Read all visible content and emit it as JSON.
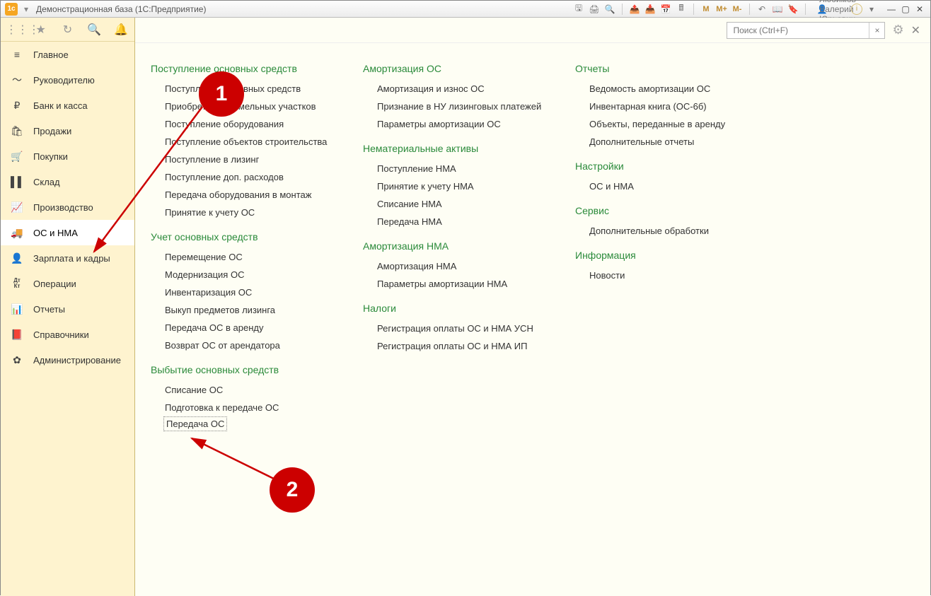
{
  "title": "Демонстрационная база  (1С:Предприятие)",
  "user": "Любимов Валерий Юрьевич",
  "toolbarLetters": {
    "m1": "M",
    "m2": "M+",
    "m3": "M-"
  },
  "search": {
    "placeholder": "Поиск (Ctrl+F)"
  },
  "nav": [
    {
      "icon": "≡",
      "label": "Главное"
    },
    {
      "icon": "〜",
      "label": "Руководителю"
    },
    {
      "icon": "₽",
      "label": "Банк и касса"
    },
    {
      "icon": "🛍",
      "label": "Продажи"
    },
    {
      "icon": "🛒",
      "label": "Покупки"
    },
    {
      "icon": "▌▌",
      "label": "Склад"
    },
    {
      "icon": "📈",
      "label": "Производство"
    },
    {
      "icon": "🚚",
      "label": "ОС и НМА",
      "active": true
    },
    {
      "icon": "👤",
      "label": "Зарплата и кадры"
    },
    {
      "icon": "Дт\nКт",
      "label": "Операции"
    },
    {
      "icon": "📊",
      "label": "Отчеты"
    },
    {
      "icon": "📕",
      "label": "Справочники"
    },
    {
      "icon": "✿",
      "label": "Администрирование"
    }
  ],
  "col1": [
    {
      "title": "Поступление основных средств",
      "items": [
        "Поступление основных средств",
        "Приобретение земельных участков",
        "Поступление оборудования",
        "Поступление объектов строительства",
        "Поступление в лизинг",
        "Поступление доп. расходов",
        "Передача оборудования в монтаж",
        "Принятие к учету ОС"
      ]
    },
    {
      "title": "Учет основных средств",
      "items": [
        "Перемещение ОС",
        "Модернизация ОС",
        "Инвентаризация ОС",
        "Выкуп предметов лизинга",
        "Передача ОС в аренду",
        "Возврат ОС от арендатора"
      ]
    },
    {
      "title": "Выбытие основных средств",
      "items": [
        "Списание ОС",
        "Подготовка к передаче ОС",
        "Передача ОС"
      ]
    }
  ],
  "col2": [
    {
      "title": "Амортизация ОС",
      "items": [
        "Амортизация и износ ОС",
        "Признание в НУ лизинговых платежей",
        "Параметры амортизации ОС"
      ]
    },
    {
      "title": "Нематериальные активы",
      "items": [
        "Поступление НМА",
        "Принятие к учету НМА",
        "Списание НМА",
        "Передача НМА"
      ]
    },
    {
      "title": "Амортизация НМА",
      "items": [
        "Амортизация НМА",
        "Параметры амортизации НМА"
      ]
    },
    {
      "title": "Налоги",
      "items": [
        "Регистрация оплаты ОС и НМА УСН",
        "Регистрация оплаты ОС и НМА ИП"
      ]
    }
  ],
  "col3": [
    {
      "title": "Отчеты",
      "items": [
        "Ведомость амортизации ОС",
        "Инвентарная книга (ОС-6б)",
        "Объекты, переданные в аренду",
        "Дополнительные отчеты"
      ]
    },
    {
      "title": "Настройки",
      "items": [
        "ОС и НМА"
      ]
    },
    {
      "title": "Сервис",
      "items": [
        "Дополнительные обработки"
      ]
    },
    {
      "title": "Информация",
      "items": [
        "Новости"
      ]
    }
  ],
  "anno": {
    "one": "1",
    "two": "2"
  }
}
